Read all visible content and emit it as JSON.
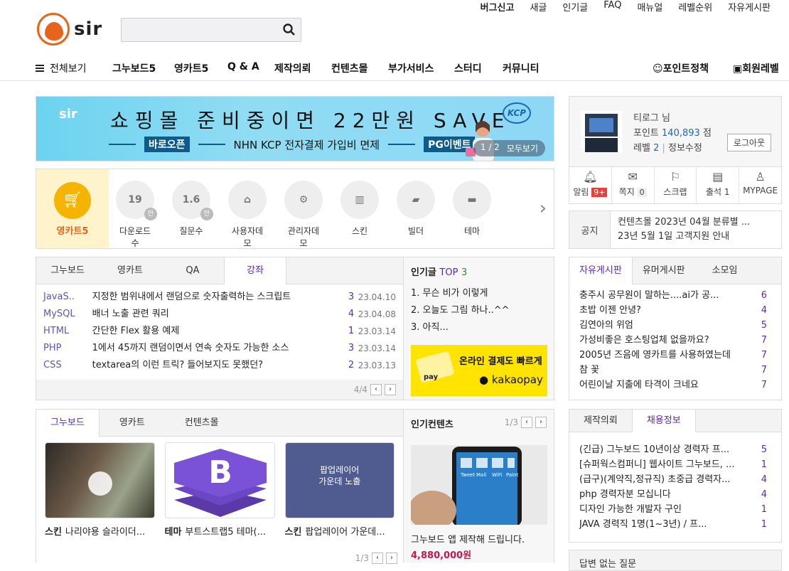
{
  "topbar": [
    "버그신고",
    "새글",
    "인기글",
    "FAQ",
    "매뉴얼",
    "레벨순위",
    "자유게시판"
  ],
  "logo_text": "sir",
  "search": {
    "placeholder": ""
  },
  "nav": {
    "all": "전체보기",
    "items": [
      "그누보드5",
      "영카트5",
      "Q & A",
      "제작의뢰",
      "컨텐츠몰",
      "부가서비스",
      "스터디",
      "커뮤니티"
    ],
    "right1": "포인트정책",
    "right2": "회원레벨"
  },
  "banner": {
    "brand": "sir",
    "headline": "쇼핑몰 준비중이면 22만원 SAVE",
    "tag1": "바로오픈",
    "middle": "NHN KCP 전자결제 가입비 면제",
    "tag2": "PG이벤트",
    "pager": "1 / 2",
    "all": "모두보기",
    "kcp": "KCP"
  },
  "profile": {
    "name": "티로그 님",
    "point_label": "포인트",
    "point": "140,893",
    "point_unit": "점",
    "level_label": "레벨",
    "level": "2",
    "edit": "정보수정",
    "logout": "로그아웃"
  },
  "icons": [
    {
      "label": "알림",
      "badge": "9+"
    },
    {
      "label": "쪽지",
      "count": "0"
    },
    {
      "label": "스크랩"
    },
    {
      "label": "출석",
      "count": "1"
    },
    {
      "label": "MYPAGE"
    }
  ],
  "notice": {
    "label": "공지",
    "line1": "컨텐츠몰 2023년 04월 분류별 ...",
    "line2": "23년 5월 1일 고객지원 안내"
  },
  "prod": {
    "main": "영카트5",
    "items": [
      {
        "val": "19",
        "man": "만",
        "label": "다운로드수"
      },
      {
        "val": "1.6",
        "man": "만",
        "label": "질문수"
      },
      {
        "icon": "home-icon",
        "label": "사용자데모"
      },
      {
        "icon": "gear-icon",
        "label": "관리자데모"
      },
      {
        "icon": "map-icon",
        "label": "스킨"
      },
      {
        "icon": "note-icon",
        "label": "빌더"
      },
      {
        "icon": "folder-icon",
        "label": "테마"
      }
    ]
  },
  "lecture": {
    "tabs": [
      "그누보드",
      "영카트",
      "QA",
      "강좌"
    ],
    "rows": [
      {
        "cat": "JavaS..",
        "title": "지정한 범위내에서 랜덤으로 숫자출력하는 스크립트",
        "n": "3",
        "date": "23.04.10"
      },
      {
        "cat": "MySQL",
        "title": "배너 노출 관련 쿼리",
        "n": "4",
        "date": "23.04.08"
      },
      {
        "cat": "HTML",
        "title": "간단한 Flex 활용 예제",
        "n": "1",
        "date": "23.03.14"
      },
      {
        "cat": "PHP",
        "title": "1에서 45까지 랜덤이면서 연속 숫자도 가능한 소스",
        "n": "3",
        "date": "23.03.14"
      },
      {
        "cat": "CSS",
        "title": "textarea의 이런 트릭? 들어보지도 못했던?",
        "n": "2",
        "date": "23.03.13"
      }
    ],
    "page": "4/4"
  },
  "popular": {
    "title": "인기글",
    "top": "TOP",
    "topn": "3",
    "items": [
      "1. 무슨 비가 이렇게",
      "2. 오늘도 그림 하나..^^",
      "3. 아직..."
    ],
    "ad1": "온라인 결제도 빠르게",
    "ad2": "kakaopay",
    "ad_pay": "pay"
  },
  "free": {
    "tabs": [
      "자유게시판",
      "유머게시판",
      "소모임"
    ],
    "rows": [
      {
        "t": "충주시 공무원이 말하는....ai가 공...",
        "n": "6"
      },
      {
        "t": "초밥 이젠 안녕?",
        "n": "4"
      },
      {
        "t": "김연아의 위엄",
        "n": "5"
      },
      {
        "t": "가성비좋은 호스팅업체 없을까요?",
        "n": "7"
      },
      {
        "t": "2005년 즈음에 영카트를 사용하였는데",
        "n": "7"
      },
      {
        "t": "참 꽃",
        "n": "7"
      },
      {
        "t": "어린이날 지출에 타격이 크네요",
        "n": "7"
      }
    ]
  },
  "gallery": {
    "tabs": [
      "그누보드",
      "영카트",
      "컨텐츠몰"
    ],
    "items": [
      {
        "tag": "스킨",
        "title": "나리야용 슬라이더..."
      },
      {
        "tag": "테마",
        "title": "부트스트랩5 테마(..."
      },
      {
        "tag": "스킨",
        "title": "팝업레이어 가운데..."
      }
    ],
    "popup_text1": "팝업레이어",
    "popup_text2": "가운데 노출",
    "page": "1/3"
  },
  "pcontent": {
    "title": "인기컨텐츠",
    "page": "1/3",
    "caption": "그누보드 앱 제작해 드립니다.",
    "price": "4,880,000원",
    "app1": "Tweet",
    "app2": "Mail",
    "app3": "WiFi",
    "app4": "Paint"
  },
  "jobs": {
    "tabs": [
      "제작의뢰",
      "채용정보"
    ],
    "rows": [
      {
        "t": "(긴급) 그누보드 10년이상 경력자 프...",
        "n": "5"
      },
      {
        "t": "[슈퍼웍스컴퍼니] 웹사이트 그누보드, ...",
        "n": "1"
      },
      {
        "t": "(급구)(계약직,정규직) 초중급 경력자...",
        "n": "4"
      },
      {
        "t": "php 경력자분 모십니다",
        "n": "4"
      },
      {
        "t": "디자인 가능한 개발자 구인",
        "n": "1"
      },
      {
        "t": "JAVA 경력직 1명(1~3년) / 프...",
        "n": "1"
      }
    ]
  },
  "unanswered": "답변 없는 질문"
}
